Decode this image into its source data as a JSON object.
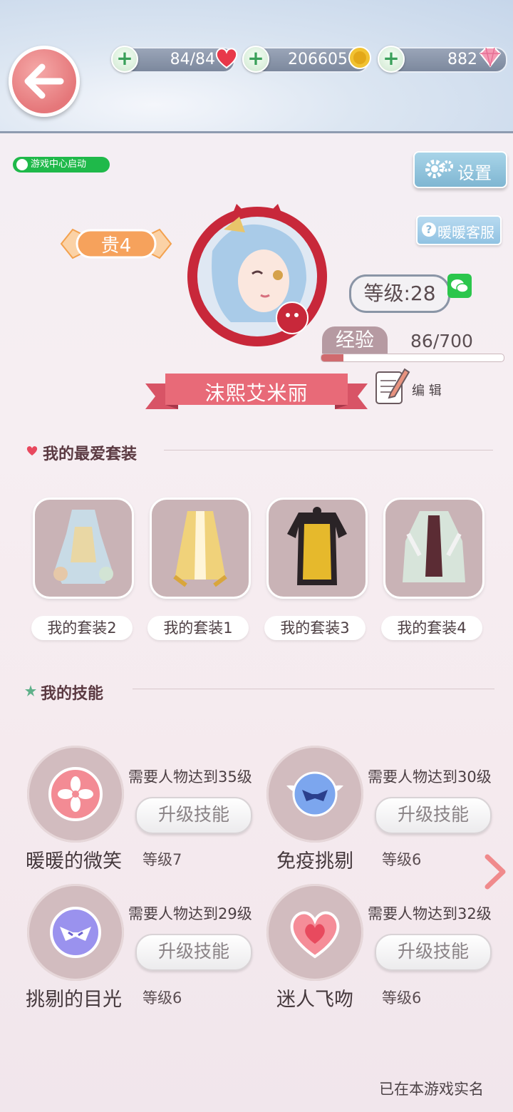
{
  "resources": {
    "hearts": "84/84",
    "coins": "206605",
    "diamonds": "882"
  },
  "game_center_label": "游戏中心启动",
  "settings_label": "设置",
  "service_label": "暖暖客服",
  "profile": {
    "noble_level": "贵4",
    "level_text": "等级:28",
    "exp_label": "经验",
    "exp_value": "86/700",
    "exp_fraction": 0.123,
    "name": "沫熙艾米丽",
    "edit_label": "编 辑"
  },
  "favorites": {
    "title": "我的最爱套装",
    "outfits": [
      {
        "label": "我的套装2"
      },
      {
        "label": "我的套装1"
      },
      {
        "label": "我的套装3"
      },
      {
        "label": "我的套装4"
      }
    ]
  },
  "skills": {
    "title": "我的技能",
    "upgrade_label": "升级技能",
    "items": [
      {
        "name": "暖暖的微笑",
        "level": "等级7",
        "requirement": "需要人物达到35级",
        "icon": "cherry-blossom-icon"
      },
      {
        "name": "免疫挑剔",
        "level": "等级6",
        "requirement": "需要人物达到30级",
        "icon": "winged-mask-icon"
      },
      {
        "name": "挑剔的目光",
        "level": "等级6",
        "requirement": "需要人物达到29级",
        "icon": "mask-icon"
      },
      {
        "name": "迷人飞吻",
        "level": "等级6",
        "requirement": "需要人物达到32级",
        "icon": "heart-icon"
      }
    ]
  },
  "footer_text": "已在本游戏实名",
  "colors": {
    "accent_red": "#e5777a",
    "ribbon": "#e86a78",
    "noble_orange": "#f6a25c"
  }
}
